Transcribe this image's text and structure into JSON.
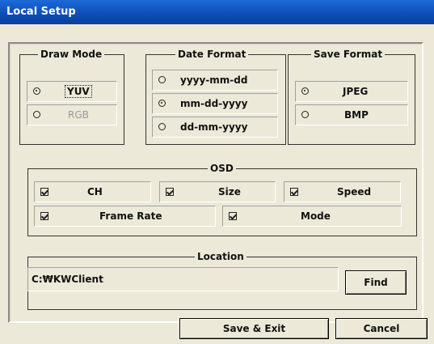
{
  "window": {
    "title": "Local Setup"
  },
  "draw_mode": {
    "legend": "Draw Mode",
    "options": [
      {
        "label": "YUV",
        "selected": true,
        "enabled": true
      },
      {
        "label": "RGB",
        "selected": false,
        "enabled": false
      }
    ]
  },
  "date_format": {
    "legend": "Date Format",
    "options": [
      {
        "label": "yyyy-mm-dd",
        "selected": false
      },
      {
        "label": "mm-dd-yyyy",
        "selected": true
      },
      {
        "label": "dd-mm-yyyy",
        "selected": false
      }
    ]
  },
  "save_format": {
    "legend": "Save Format",
    "options": [
      {
        "label": "JPEG",
        "selected": true
      },
      {
        "label": "BMP",
        "selected": false
      }
    ]
  },
  "osd": {
    "legend": "OSD",
    "items": [
      {
        "label": "CH",
        "checked": true
      },
      {
        "label": "Size",
        "checked": true
      },
      {
        "label": "Speed",
        "checked": true
      },
      {
        "label": "Frame Rate",
        "checked": true
      },
      {
        "label": "Mode",
        "checked": true
      }
    ]
  },
  "location": {
    "legend": "Location",
    "path": "C:₩KWClient",
    "find_label": "Find"
  },
  "footer": {
    "save_exit_label": "Save & Exit",
    "cancel_label": "Cancel"
  }
}
